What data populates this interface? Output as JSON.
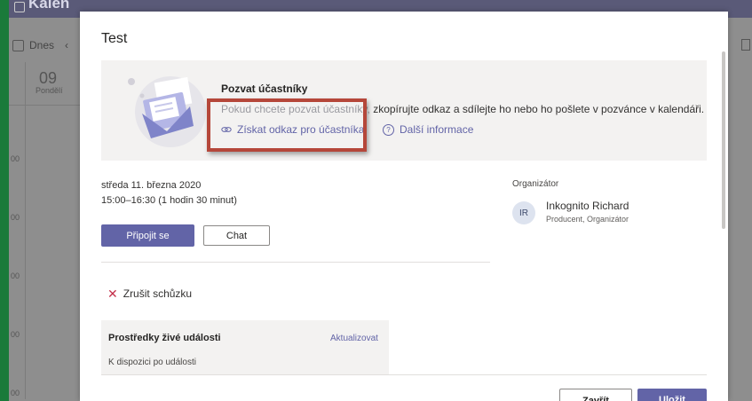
{
  "background": {
    "app_title": "Kalen",
    "today_label": "Dnes",
    "day_number": "09",
    "day_name": "Pondělí",
    "hours": [
      "00",
      "00",
      "00",
      "00",
      "00"
    ]
  },
  "modal": {
    "title": "Test",
    "invite": {
      "title": "Pozvat účastníky",
      "text_faded": "Pokud chcete pozvat účastníky,",
      "text": " zkopírujte odkaz a sdílejte ho nebo ho pošlete v pozvánce v kalendáři.",
      "get_link_label": "Získat odkaz pro účastníka",
      "more_info_label": "Další informace"
    },
    "meeting": {
      "date": "středa 11. března 2020",
      "time": "15:00–16:30 (1 hodin 30 minut)"
    },
    "organizer": {
      "label": "Organizátor",
      "initials": "IR",
      "name": "Inkognito Richard",
      "role": "Producent, Organizátor"
    },
    "buttons": {
      "join": "Připojit se",
      "chat": "Chat",
      "close": "Zavřít",
      "save": "Uložit"
    },
    "cancel_meeting": "Zrušit schůzku",
    "live_resources": {
      "title": "Prostředky živé události",
      "update": "Aktualizovat",
      "status": "K dispozici po události"
    }
  },
  "colors": {
    "accent": "#6264a7",
    "highlight": "#b5473a",
    "frame": "#1a7a3a"
  }
}
